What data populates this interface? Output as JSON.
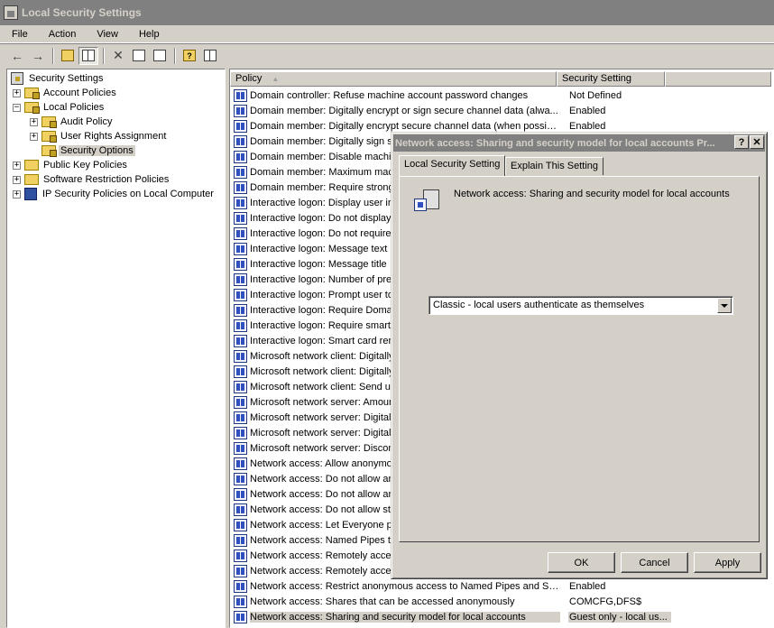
{
  "window": {
    "title": "Local Security Settings"
  },
  "menu": [
    "File",
    "Action",
    "View",
    "Help"
  ],
  "toolbar": {
    "back_icon": "back-arrow-icon",
    "forward_icon": "forward-arrow-icon"
  },
  "tree": {
    "root": "Security Settings",
    "items": [
      {
        "label": "Account Policies",
        "expander": "+",
        "level": 1
      },
      {
        "label": "Local Policies",
        "expander": "−",
        "level": 1
      },
      {
        "label": "Audit Policy",
        "expander": "+",
        "level": 2
      },
      {
        "label": "User Rights Assignment",
        "expander": "+",
        "level": 2
      },
      {
        "label": "Security Options",
        "expander": "",
        "level": 2,
        "selected": true
      },
      {
        "label": "Public Key Policies",
        "expander": "+",
        "level": 1
      },
      {
        "label": "Software Restriction Policies",
        "expander": "+",
        "level": 1
      },
      {
        "label": "IP Security Policies on Local Computer",
        "expander": "+",
        "level": 1
      }
    ]
  },
  "list": {
    "columns": {
      "policy": "Policy",
      "setting": "Security Setting",
      "sort_indicator": "▲"
    },
    "rows": [
      {
        "policy": "Domain controller: Refuse machine account password changes",
        "setting": "Not Defined"
      },
      {
        "policy": "Domain member: Digitally encrypt or sign secure channel data (alwa...",
        "setting": "Enabled"
      },
      {
        "policy": "Domain member: Digitally encrypt secure channel data (when possible)",
        "setting": "Enabled"
      },
      {
        "policy": "Domain member: Digitally sign se",
        "setting": ""
      },
      {
        "policy": "Domain member: Disable machine",
        "setting": ""
      },
      {
        "policy": "Domain member: Maximum mach",
        "setting": ""
      },
      {
        "policy": "Domain member: Require strong",
        "setting": ""
      },
      {
        "policy": "Interactive logon: Display user ir",
        "setting": ""
      },
      {
        "policy": "Interactive logon: Do not display",
        "setting": ""
      },
      {
        "policy": "Interactive logon: Do not require",
        "setting": ""
      },
      {
        "policy": "Interactive logon: Message text",
        "setting": ""
      },
      {
        "policy": "Interactive logon: Message title",
        "setting": ""
      },
      {
        "policy": "Interactive logon: Number of pre",
        "setting": ""
      },
      {
        "policy": "Interactive logon: Prompt user to",
        "setting": ""
      },
      {
        "policy": "Interactive logon: Require Doma",
        "setting": ""
      },
      {
        "policy": "Interactive logon: Require smart",
        "setting": ""
      },
      {
        "policy": "Interactive logon: Smart card rem",
        "setting": ""
      },
      {
        "policy": "Microsoft network client: Digitally",
        "setting": ""
      },
      {
        "policy": "Microsoft network client: Digitally",
        "setting": ""
      },
      {
        "policy": "Microsoft network client: Send un",
        "setting": ""
      },
      {
        "policy": "Microsoft network server: Amoun",
        "setting": ""
      },
      {
        "policy": "Microsoft network server: Digital",
        "setting": ""
      },
      {
        "policy": "Microsoft network server: Digital",
        "setting": ""
      },
      {
        "policy": "Microsoft network server: Discon",
        "setting": ""
      },
      {
        "policy": "Network access: Allow anonymou",
        "setting": ""
      },
      {
        "policy": "Network access: Do not allow an",
        "setting": ""
      },
      {
        "policy": "Network access: Do not allow an",
        "setting": ""
      },
      {
        "policy": "Network access: Do not allow sto",
        "setting": ""
      },
      {
        "policy": "Network access: Let Everyone p",
        "setting": ""
      },
      {
        "policy": "Network access: Named Pipes th",
        "setting": ""
      },
      {
        "policy": "Network access: Remotely acces",
        "setting": ""
      },
      {
        "policy": "Network access: Remotely acces",
        "setting": ""
      },
      {
        "policy": "Network access: Restrict anonymous access to Named Pipes and Sh...",
        "setting": "Enabled"
      },
      {
        "policy": "Network access: Shares that can be accessed anonymously",
        "setting": "COMCFG,DFS$"
      },
      {
        "policy": "Network access: Sharing and security model for local accounts",
        "setting": "Guest only - local us...",
        "selected": true
      }
    ]
  },
  "dialog": {
    "title": "Network access: Sharing and security model for local accounts Pr...",
    "help_button": "?",
    "close_button": "✕",
    "tabs": [
      "Local Security Setting",
      "Explain This Setting"
    ],
    "policy_name": "Network access: Sharing and security model for local accounts",
    "combo_value": "Classic - local users authenticate as themselves",
    "buttons": {
      "ok": "OK",
      "cancel": "Cancel",
      "apply": "Apply"
    }
  }
}
